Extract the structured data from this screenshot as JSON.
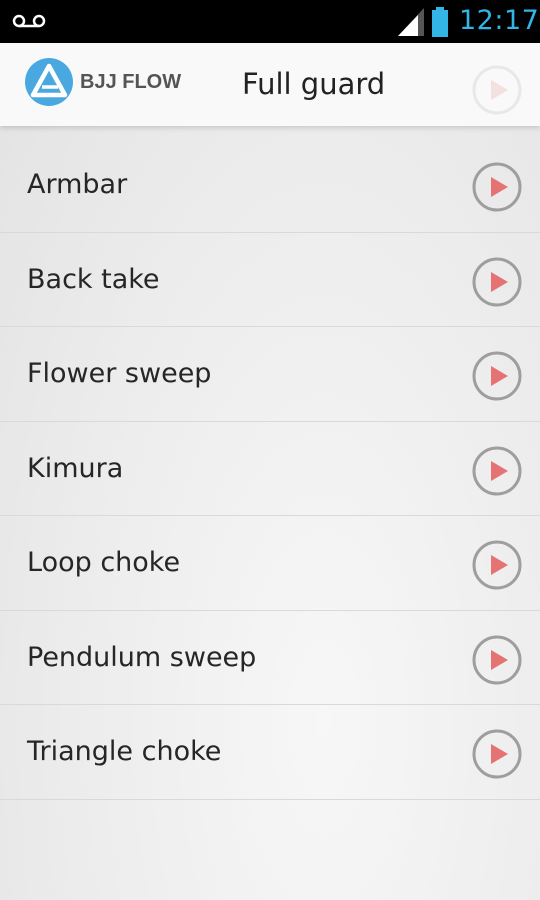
{
  "status_bar": {
    "time": "12:17",
    "icons": [
      "voicemail-icon",
      "signal-icon",
      "battery-icon"
    ]
  },
  "action_bar": {
    "app_name": "BJJ FLOW",
    "title": "Full guard",
    "logo_icon": "bjj-flow-logo-icon",
    "accent": "#4aa8e0"
  },
  "moves": [
    {
      "label": "Armbar"
    },
    {
      "label": "Back take"
    },
    {
      "label": "Flower sweep"
    },
    {
      "label": "Kimura"
    },
    {
      "label": "Loop choke"
    },
    {
      "label": "Pendulum sweep"
    },
    {
      "label": "Triangle choke"
    }
  ],
  "colors": {
    "play_fill": "#e57373",
    "play_ring": "#9e9e9e",
    "clock": "#33b5e5"
  }
}
